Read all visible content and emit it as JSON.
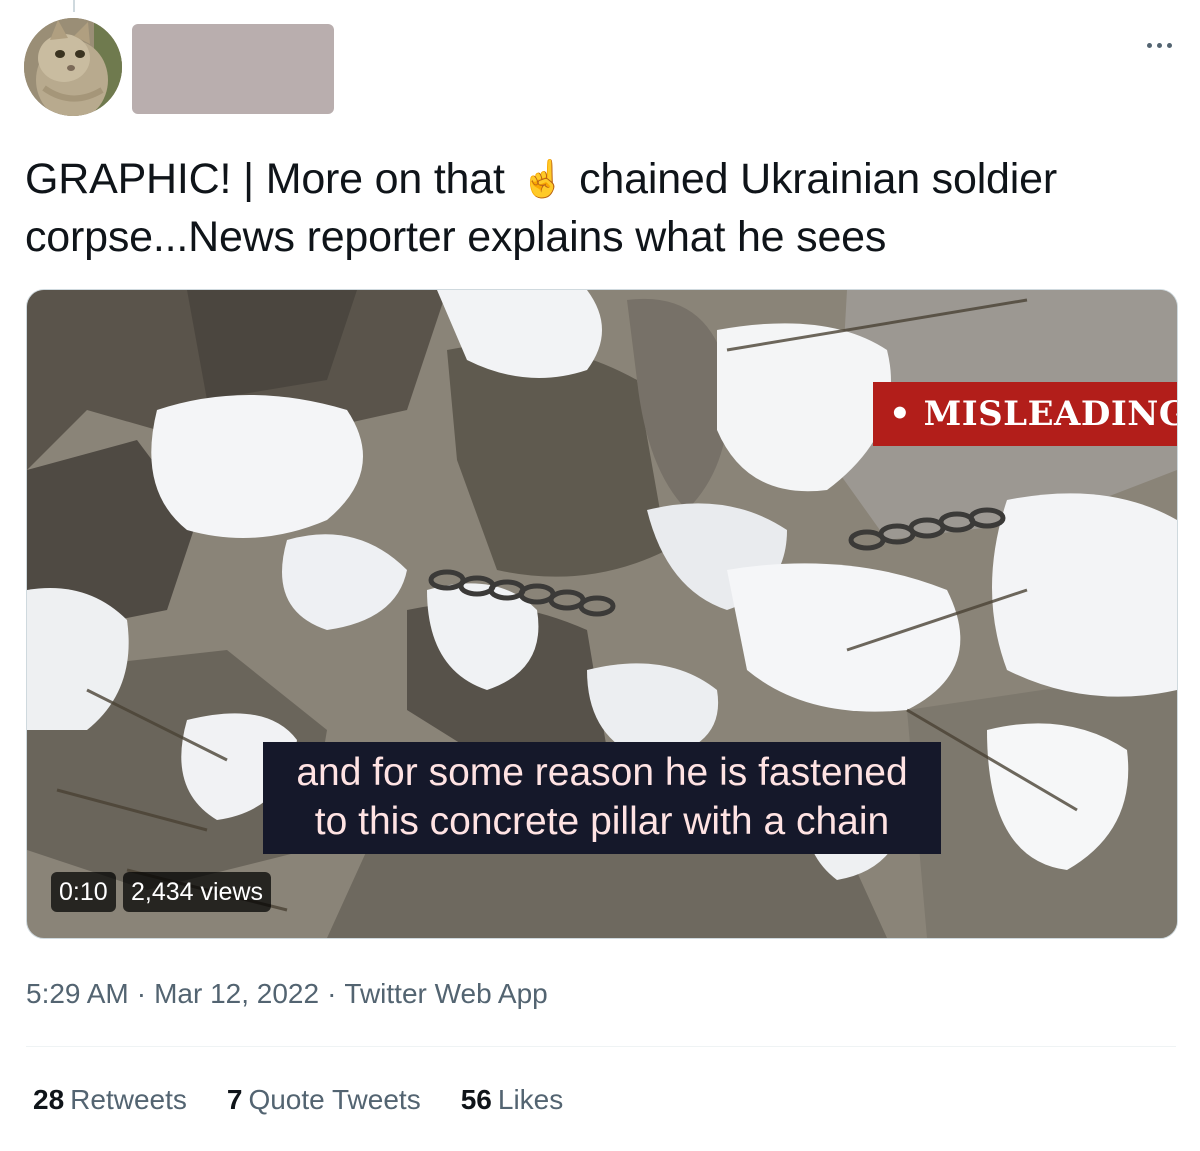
{
  "tweet": {
    "text_before_emoji": "GRAPHIC! | More on that",
    "emoji": "☝️",
    "text_after_emoji": "chained Ukrainian soldier corpse...News reporter explains what he sees"
  },
  "media": {
    "label": "• MISLEADING",
    "caption_line1": "and for some reason he is fastened",
    "caption_line2": "to this concrete pillar with a chain",
    "duration": "0:10",
    "views": "2,434 views"
  },
  "meta": {
    "time": "5:29 AM",
    "date": "Mar 12, 2022",
    "source": "Twitter Web App",
    "separator": "·"
  },
  "stats": [
    {
      "count": "28",
      "label": "Retweets"
    },
    {
      "count": "7",
      "label": "Quote Tweets"
    },
    {
      "count": "56",
      "label": "Likes"
    }
  ],
  "icons": {
    "more": "more-horizontal-icon"
  },
  "colors": {
    "misleading_label_bg": "#b21e1a",
    "caption_bg": "#15182a",
    "redacted_name": "#b9aeae",
    "secondary_text": "#536471"
  }
}
